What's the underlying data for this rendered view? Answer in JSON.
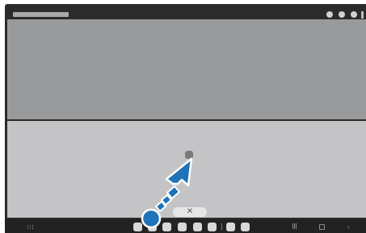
{
  "status_bar": {
    "pill_icon": "notification-bar-icon",
    "dots_icon": "status-dot-icon"
  },
  "split_view": {
    "top_window": "top-app-window",
    "bottom_window": "bottom-app-window",
    "handle_icon": "drag-handle-icon"
  },
  "popup": {
    "close_label": "✕"
  },
  "taskbar": {
    "apps_icon": "apps-grid-icon",
    "app_count": 8,
    "back_label": "‹"
  },
  "gesture": {
    "touch_icon": "touch-point-icon",
    "arrow_icon": "drag-arrow-icon",
    "colors": {
      "arrow_fill": "#1f73b8",
      "arrow_outline": "#ffffff"
    }
  }
}
